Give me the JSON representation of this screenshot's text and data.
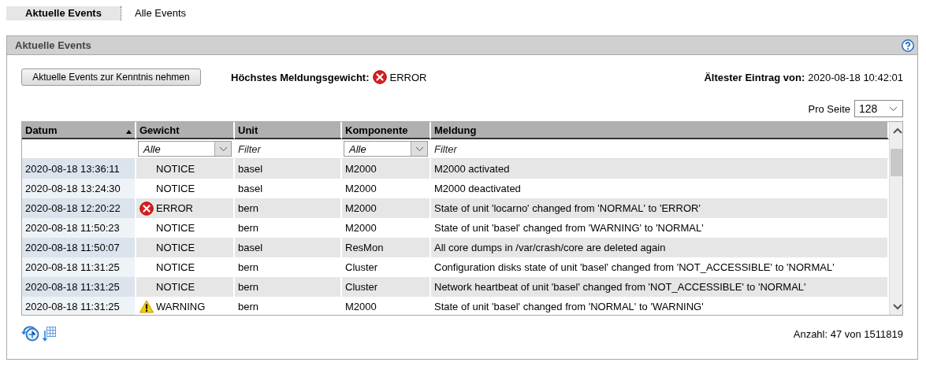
{
  "tabs": [
    {
      "label": "Aktuelle Events",
      "selected": true
    },
    {
      "label": "Alle Events",
      "selected": false
    }
  ],
  "panel": {
    "title": "Aktuelle Events",
    "acknowledge_button": "Aktuelle Events zur Kenntnis nehmen",
    "highest_severity": {
      "label": "Höchstes Meldungsgewicht:",
      "kind": "error",
      "text": "ERROR"
    },
    "oldest_entry": {
      "label": "Ältester Eintrag von:",
      "value": "2020-08-18 10:42:01"
    },
    "per_page": {
      "label": "Pro Seite",
      "value": "128"
    },
    "table": {
      "columns": [
        {
          "label": "Datum",
          "sorted": true,
          "filter": {
            "kind": "none"
          }
        },
        {
          "label": "Gewicht",
          "sorted": false,
          "filter": {
            "kind": "select",
            "value": "Alle"
          }
        },
        {
          "label": "Unit",
          "sorted": false,
          "filter": {
            "kind": "text",
            "placeholder": "Filter"
          }
        },
        {
          "label": "Komponente",
          "sorted": false,
          "filter": {
            "kind": "select",
            "value": "Alle"
          }
        },
        {
          "label": "Meldung",
          "sorted": false,
          "filter": {
            "kind": "text",
            "placeholder": "Filter"
          }
        }
      ],
      "rows": [
        {
          "date": "2020-08-18 13:36:11",
          "kind": "notice",
          "weight": "NOTICE",
          "unit": "basel",
          "component": "M2000",
          "message": "M2000 activated"
        },
        {
          "date": "2020-08-18 13:24:30",
          "kind": "notice",
          "weight": "NOTICE",
          "unit": "basel",
          "component": "M2000",
          "message": "M2000 deactivated"
        },
        {
          "date": "2020-08-18 12:20:22",
          "kind": "error",
          "weight": "ERROR",
          "unit": "bern",
          "component": "M2000",
          "message": "State of unit 'locarno' changed from 'NORMAL' to 'ERROR'"
        },
        {
          "date": "2020-08-18 11:50:23",
          "kind": "notice",
          "weight": "NOTICE",
          "unit": "bern",
          "component": "M2000",
          "message": "State of unit 'basel' changed from 'WARNING' to 'NORMAL'"
        },
        {
          "date": "2020-08-18 11:50:07",
          "kind": "notice",
          "weight": "NOTICE",
          "unit": "basel",
          "component": "ResMon",
          "message": "All core dumps in /var/crash/core are deleted again"
        },
        {
          "date": "2020-08-18 11:31:25",
          "kind": "notice",
          "weight": "NOTICE",
          "unit": "bern",
          "component": "Cluster",
          "message": "Configuration disks state of unit 'basel' changed from 'NOT_ACCESSIBLE' to 'NORMAL'"
        },
        {
          "date": "2020-08-18 11:31:25",
          "kind": "notice",
          "weight": "NOTICE",
          "unit": "bern",
          "component": "Cluster",
          "message": "Network heartbeat of unit 'basel' changed from 'NOT_ACCESSIBLE' to 'NORMAL'"
        },
        {
          "date": "2020-08-18 11:31:25",
          "kind": "warning",
          "weight": "WARNING",
          "unit": "bern",
          "component": "M2000",
          "message": "State of unit 'basel' changed from 'NORMAL' to 'WARNING'"
        }
      ]
    },
    "count": "Anzahl: 47 von 1511819"
  }
}
